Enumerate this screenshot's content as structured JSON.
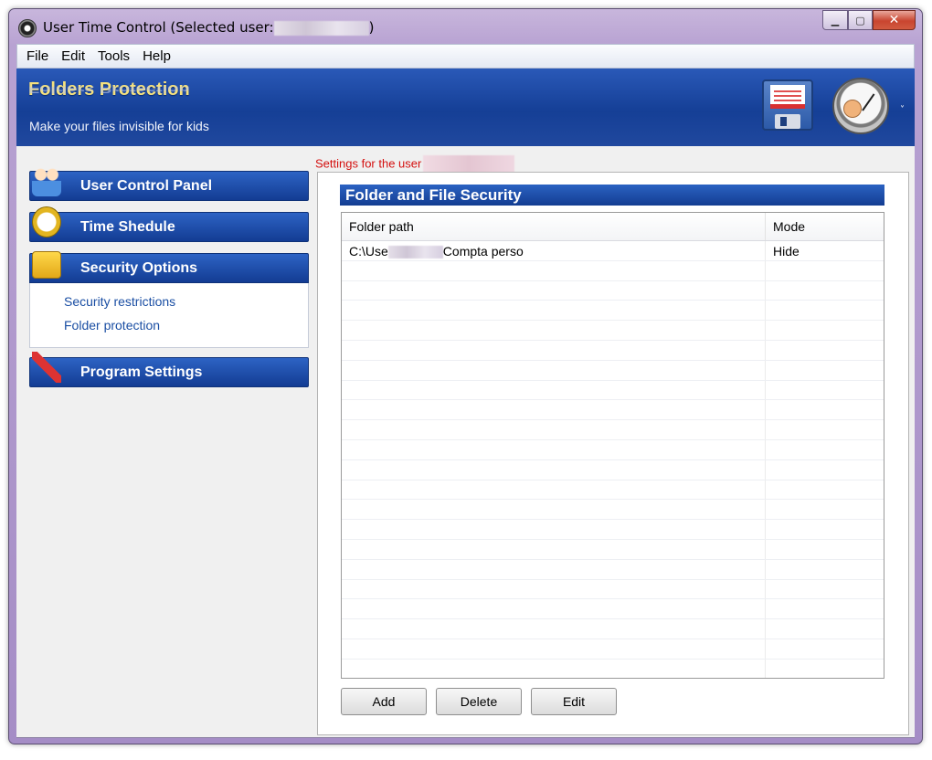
{
  "window": {
    "title": "User Time Control (Selected user:",
    "title_suffix": ")",
    "controls": {
      "minimize": "▁",
      "maximize": "▢",
      "close": "✕"
    }
  },
  "menu": [
    "File",
    "Edit",
    "Tools",
    "Help"
  ],
  "banner": {
    "title": "Folders Protection",
    "subtitle": "Make your files invisible for kids",
    "dropdown": "˅"
  },
  "settings_for": "Settings for the user",
  "sidebar": {
    "sections": [
      {
        "label": "User Control Panel",
        "icon": "users-icon"
      },
      {
        "label": "Time Shedule",
        "icon": "clock-icon"
      },
      {
        "label": "Security Options",
        "icon": "lock-icon"
      },
      {
        "label": "Program Settings",
        "icon": "tools-icon"
      }
    ],
    "security_links": [
      "Security restrictions",
      "Folder protection"
    ]
  },
  "main": {
    "section_title": "Folder and File Security",
    "columns": [
      "Folder path",
      "Mode"
    ],
    "rows": [
      {
        "path_prefix": "C:\\Use",
        "path_suffix": "Compta perso",
        "mode": "Hide"
      }
    ],
    "buttons": {
      "add": "Add",
      "delete": "Delete",
      "edit": "Edit"
    }
  },
  "colors": {
    "header_blue": "#1a4aa8",
    "banner_title": "#f5e17e",
    "settings_text": "#d4100f",
    "link_blue": "#1a4ea3"
  }
}
